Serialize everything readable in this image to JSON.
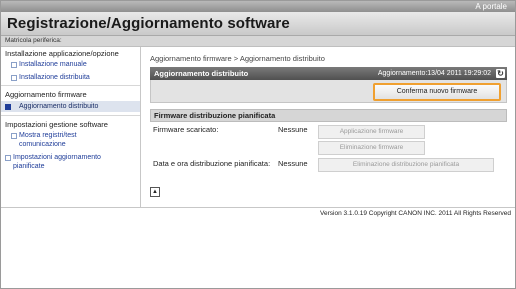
{
  "header": {
    "portal_link": "A portale",
    "app_title": "Registrazione/Aggiornamento software",
    "device_label": "Matricola periferica:"
  },
  "sidebar": {
    "sections": [
      {
        "label": "Installazione applicazione/opzione",
        "items": [
          "Installazione manuale",
          "Installazione distribuita"
        ]
      },
      {
        "label": "Aggiornamento firmware",
        "items": [
          "Aggiornamento distribuito"
        ]
      },
      {
        "label": "Impostazioni gestione software",
        "items": [
          "Mostra registri/test comunicazione",
          "Impostazioni aggiornamento pianificate"
        ]
      }
    ]
  },
  "main": {
    "breadcrumb": "Aggiornamento firmware > Aggiornamento distribuito",
    "panel": {
      "title": "Aggiornamento distribuito",
      "timestamp": "Aggiornamento:13/04 2011 19:29:02",
      "confirm_button": "Conferma nuovo firmware"
    },
    "plan": {
      "title": "Firmware distribuzione pianificata",
      "downloaded_label": "Firmware scaricato:",
      "downloaded_value": "Nessune",
      "apply_button": "Applicazione firmware",
      "delete_button": "Eliminazione firmware",
      "datetime_label": "Data e ora distribuzione pianificata:",
      "datetime_value": "Nessune",
      "cancel_plan_button": "Eliminazione distribuzione pianificata"
    }
  },
  "footer": {
    "copyright": "Version 3.1.0.19 Copyright CANON INC. 2011 All Rights Reserved"
  }
}
